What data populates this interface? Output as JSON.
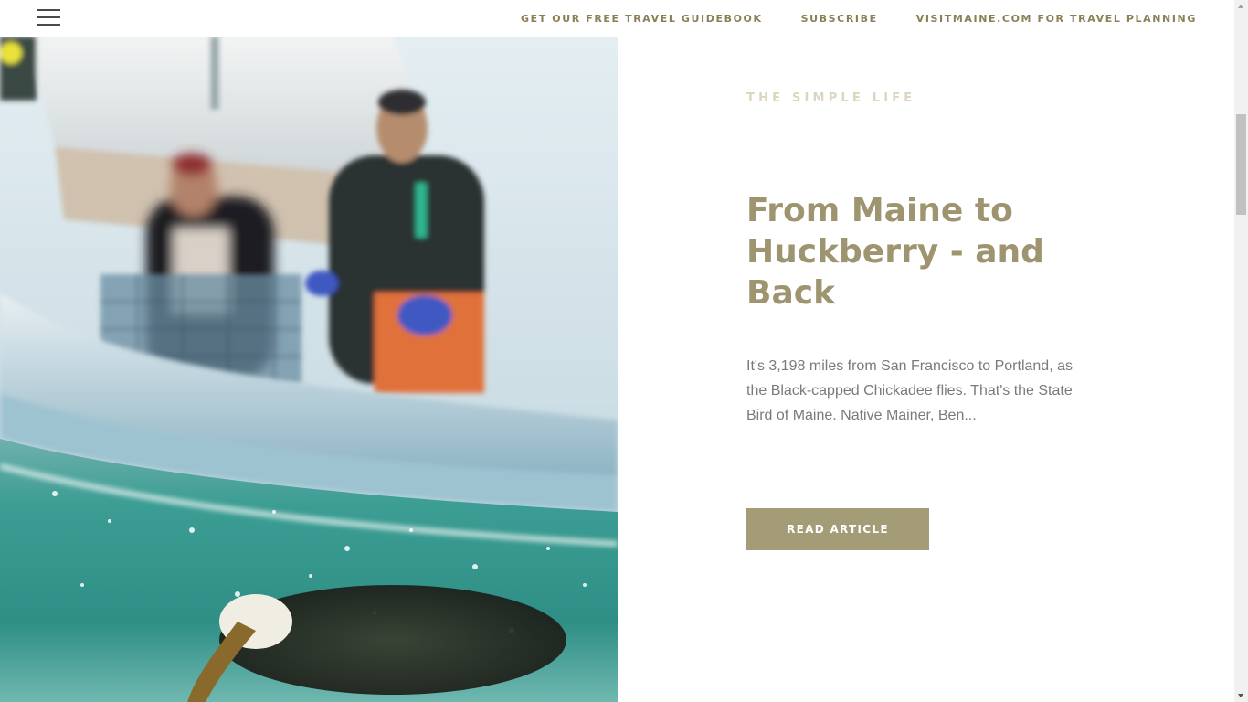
{
  "nav": {
    "menu_icon": "hamburger-menu-icon",
    "links": [
      "GET OUR FREE TRAVEL GUIDEBOOK",
      "SUBSCRIBE",
      "VISITMAINE.COM FOR TRAVEL PLANNING"
    ]
  },
  "hero": {
    "image_desc": "lobster-boat-photo"
  },
  "article": {
    "category": "THE SIMPLE LIFE",
    "title": "From Maine to Huckberry - and Back",
    "excerpt": "It's 3,198 miles from San Francisco to Portland, as the Black-capped Chickadee flies. That's the State Bird of Maine. Native Mainer, Ben...",
    "button_label": "READ ARTICLE"
  },
  "colors": {
    "accent": "#a39c76",
    "nav_text": "#8a7f55",
    "category_text": "#dcd6bd",
    "title_text": "#9e9470",
    "body_text": "#7a7a7a"
  }
}
